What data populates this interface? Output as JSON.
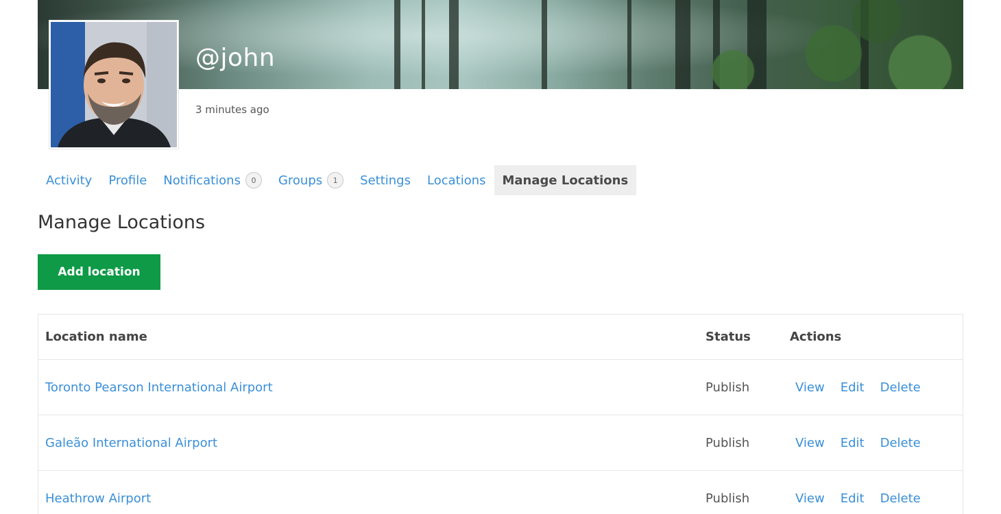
{
  "profile": {
    "handle": "@john",
    "last_active": "3 minutes ago"
  },
  "tabs": [
    {
      "label": "Activity",
      "active": false
    },
    {
      "label": "Profile",
      "active": false
    },
    {
      "label": "Notifications",
      "badge": "0",
      "active": false
    },
    {
      "label": "Groups",
      "badge": "1",
      "active": false
    },
    {
      "label": "Settings",
      "active": false
    },
    {
      "label": "Locations",
      "active": false
    },
    {
      "label": "Manage Locations",
      "active": true
    }
  ],
  "main": {
    "title": "Manage Locations",
    "add_button_label": "Add location"
  },
  "table": {
    "headers": {
      "name": "Location name",
      "status": "Status",
      "actions": "Actions"
    },
    "action_labels": {
      "view": "View",
      "edit": "Edit",
      "delete": "Delete"
    },
    "rows": [
      {
        "name": "Toronto Pearson International Airport",
        "status": "Publish"
      },
      {
        "name": "Galeão International Airport",
        "status": "Publish"
      },
      {
        "name": "Heathrow Airport",
        "status": "Publish"
      }
    ]
  },
  "colors": {
    "link": "#3a8fd8",
    "primary_button": "#0e9a46",
    "active_tab_bg": "#eeeeee"
  }
}
